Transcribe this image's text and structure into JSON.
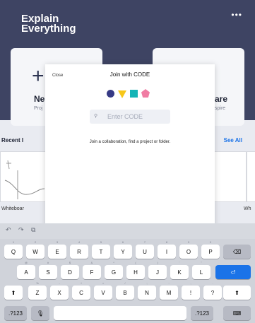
{
  "app": {
    "brand_line1": "Explain",
    "brand_line2": "Everything",
    "more": "•••"
  },
  "background": {
    "new_card": {
      "plus": "+",
      "title": "Ne",
      "subtitle": "Proj"
    },
    "share_card": {
      "arrow": "↗",
      "title": "are",
      "subtitle": "spire"
    },
    "recent_label": "Recent I",
    "see_all": "See All",
    "thumb_titles": [
      "Whiteboar",
      "Wh"
    ]
  },
  "modal": {
    "close_label": "Close",
    "title": "Join with CODE",
    "code_placeholder": "Enter CODE",
    "help_text": "Join a collaboration, find a project or folder.",
    "colors": {
      "circle": "#363a85",
      "triangle": "#f7c719",
      "square": "#14b4b6",
      "pentagon": "#f07ca3"
    }
  },
  "toolbar": {
    "undo": "↶",
    "redo": "↷",
    "clipboard": "⧉"
  },
  "keyboard": {
    "row1": [
      "Q",
      "W",
      "E",
      "R",
      "T",
      "Y",
      "U",
      "I",
      "O",
      "P"
    ],
    "row1_nums": [
      "1",
      "2",
      "3",
      "4",
      "5",
      "6",
      "7",
      "8",
      "9",
      "0"
    ],
    "row2": [
      "A",
      "S",
      "D",
      "F",
      "G",
      "H",
      "J",
      "K",
      "L"
    ],
    "row2_nums": [
      "@",
      "#",
      "$",
      "&",
      "*",
      "(",
      ")",
      "'",
      "\""
    ],
    "row3": [
      "Z",
      "X",
      "C",
      "V",
      "B",
      "N",
      "M",
      "!",
      "?"
    ],
    "row3_nums": [
      "%",
      "-",
      "+",
      "=",
      "/",
      ";",
      ":",
      ",",
      "."
    ],
    "special": {
      "backspace": "⌫",
      "return": "⏎",
      "shift": "⬆",
      "numbers": ".?123",
      "mic": "🎙",
      "hide": "⌨"
    }
  }
}
